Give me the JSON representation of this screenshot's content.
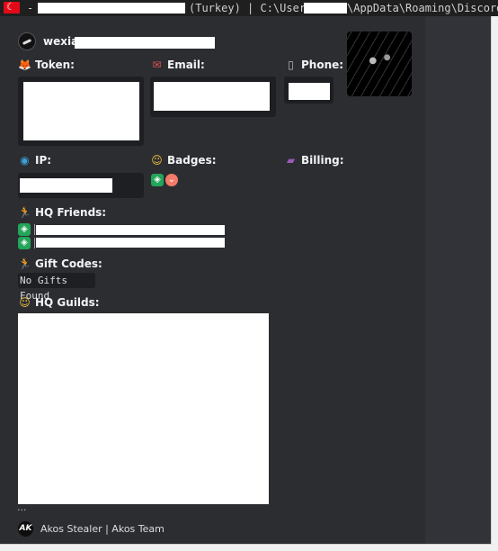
{
  "titlebar": {
    "dash": "-",
    "fragment_1": "(Turkey) | C:\\Users\\",
    "fragment_2": "\\AppData\\Roaming\\Discord"
  },
  "author": {
    "name": "wexian"
  },
  "fields": {
    "token_label": "Token:",
    "email_label": "Email:",
    "phone_label": "Phone:",
    "ip_label": "IP:",
    "badges_label": "Badges:",
    "billing_label": "Billing:",
    "friends_label": "HQ Friends:",
    "gifts_label": "Gift Codes:",
    "gifts_value": "No Gifts Found",
    "guilds_label": "HQ Guilds:",
    "guilds_more": "..."
  },
  "icons": {
    "token": "fox-face-icon",
    "email": "envelope-icon",
    "phone": "mobile-phone-icon",
    "ip": "globe-icon",
    "badges": "smirk-face-icon",
    "billing": "credit-card-icon",
    "friends": "running-person-icon",
    "gifts": "running-person-icon",
    "guilds": "smirk-face-icon"
  },
  "footer": {
    "logo_text": "AK",
    "text": "Akos Stealer | Akos Team"
  },
  "colors": {
    "embed_bg": "#2b2d31",
    "codebox_bg": "#1e1f22",
    "badge_green": "#23a55a",
    "badge_pink": "#f47b67"
  }
}
